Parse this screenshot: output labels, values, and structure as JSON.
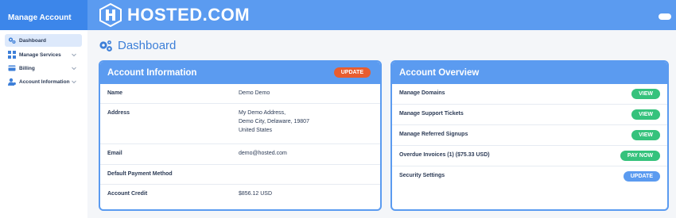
{
  "sidebar": {
    "heading": "Manage Account",
    "items": [
      {
        "label": "Dashboard"
      },
      {
        "label": "Manage Services"
      },
      {
        "label": "Billing"
      },
      {
        "label": "Account Information"
      }
    ]
  },
  "header": {
    "logo_text": "HOSTED.COM"
  },
  "page": {
    "title": "Dashboard"
  },
  "account_info": {
    "title": "Account Information",
    "update_label": "UPDATE",
    "rows": [
      {
        "label": "Name",
        "value": "Demo Demo"
      },
      {
        "label": "Address",
        "lines": [
          "My Demo Address,",
          "Demo City, Delaware, 19807",
          "United States"
        ]
      },
      {
        "label": "Email",
        "value": "demo@hosted.com"
      },
      {
        "label": "Default Payment Method",
        "value": ""
      },
      {
        "label": "Account Credit",
        "value": "$856.12 USD"
      }
    ]
  },
  "account_overview": {
    "title": "Account Overview",
    "rows": [
      {
        "label": "Manage Domains",
        "button": "VIEW"
      },
      {
        "label": "Manage Support Tickets",
        "button": "VIEW"
      },
      {
        "label": "Manage Referred Signups",
        "button": "VIEW"
      },
      {
        "label": "Overdue Invoices (1) ($75.33 USD)",
        "button": "PAY NOW"
      },
      {
        "label": "Security Settings",
        "button": "UPDATE"
      }
    ]
  },
  "colors": {
    "brand_blue": "#5b9bf0",
    "update_red": "#e85d2f",
    "action_green": "#35c27c",
    "title_blue": "#3d7fd8"
  }
}
